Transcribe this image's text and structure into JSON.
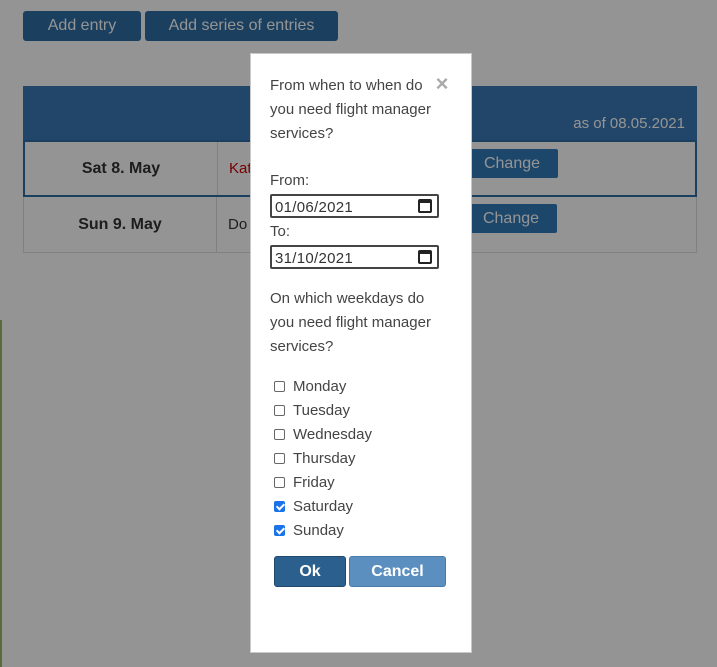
{
  "toolbar": {
    "add_entry_label": "Add entry",
    "add_series_label": "Add series of entries"
  },
  "table": {
    "as_of": "as of 08.05.2021",
    "rows": [
      {
        "date": "Sat 8. May",
        "name": "Kat",
        "name_color": "#cc0000",
        "change_label": "Change"
      },
      {
        "date": "Sun 9. May",
        "name": "Do",
        "name_color": "#333333",
        "change_label": "Change"
      }
    ]
  },
  "modal": {
    "title": "From when to when do you need flight manager services?",
    "close_icon": "close-icon",
    "from_label": "From:",
    "from_value": "01/06/2021",
    "to_label": "To:",
    "to_value": "31/10/2021",
    "weekday_question": "On which weekdays do you need flight manager services?",
    "weekdays": [
      {
        "label": "Monday",
        "checked": false
      },
      {
        "label": "Tuesday",
        "checked": false
      },
      {
        "label": "Wednesday",
        "checked": false
      },
      {
        "label": "Thursday",
        "checked": false
      },
      {
        "label": "Friday",
        "checked": false
      },
      {
        "label": "Saturday",
        "checked": true
      },
      {
        "label": "Sunday",
        "checked": true
      }
    ],
    "ok_label": "Ok",
    "cancel_label": "Cancel"
  },
  "colors": {
    "primary": "#2e6da4",
    "checkbox_accent": "#1a73e8"
  }
}
